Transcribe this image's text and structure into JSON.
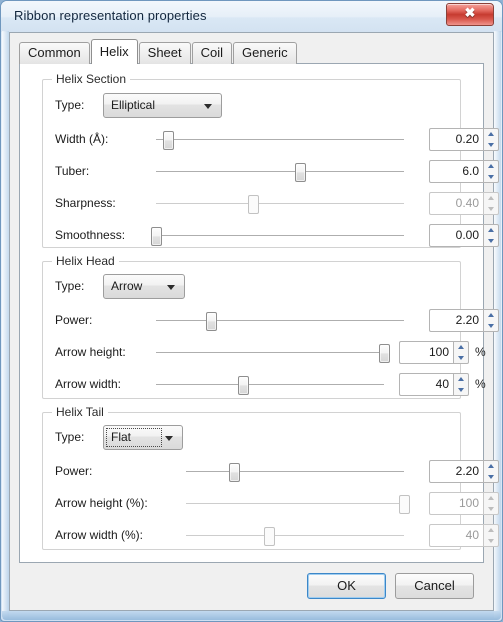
{
  "window": {
    "title": "Ribbon representation properties",
    "close_icon": "close-icon",
    "close_glyph": "✖"
  },
  "tabs": [
    {
      "label": "Common",
      "selected": false
    },
    {
      "label": "Helix",
      "selected": true
    },
    {
      "label": "Sheet",
      "selected": false
    },
    {
      "label": "Coil",
      "selected": false
    },
    {
      "label": "Generic",
      "selected": false
    }
  ],
  "helix_section": {
    "legend": "Helix Section",
    "type": {
      "label": "Type:",
      "value": "Elliptical"
    },
    "width": {
      "label": "Width (Å):",
      "value": "0.20",
      "percent": 5,
      "disabled": false
    },
    "tuber": {
      "label": "Tuber:",
      "value": "6.0",
      "percent": 58,
      "disabled": false
    },
    "sharpness": {
      "label": "Sharpness:",
      "value": "0.40",
      "percent": 39,
      "disabled": true
    },
    "smoothness": {
      "label": "Smoothness:",
      "value": "0.00",
      "percent": 0,
      "disabled": false
    }
  },
  "helix_head": {
    "legend": "Helix Head",
    "type": {
      "label": "Type:",
      "value": "Arrow"
    },
    "power": {
      "label": "Power:",
      "value": "2.20",
      "percent": 22,
      "disabled": false
    },
    "arrow_height": {
      "label": "Arrow height:",
      "value": "100",
      "unit": "%",
      "percent": 100,
      "disabled": false
    },
    "arrow_width": {
      "label": "Arrow width:",
      "value": "40",
      "unit": "%",
      "percent": 38,
      "disabled": false
    }
  },
  "helix_tail": {
    "legend": "Helix Tail",
    "type": {
      "label": "Type:",
      "value": "Flat",
      "focused": true
    },
    "power": {
      "label": "Power:",
      "value": "2.20",
      "percent": 22,
      "disabled": false
    },
    "arrow_height": {
      "label": "Arrow height (%):",
      "value": "100",
      "percent": 100,
      "disabled": true
    },
    "arrow_width": {
      "label": "Arrow width (%):",
      "value": "40",
      "percent": 38,
      "disabled": true
    }
  },
  "buttons": {
    "ok": "OK",
    "cancel": "Cancel"
  },
  "colors": {
    "accent": "#3c87c8",
    "close_button": "#c63b30",
    "panel": "#ffffff",
    "dialog": "#f0f0f0"
  }
}
